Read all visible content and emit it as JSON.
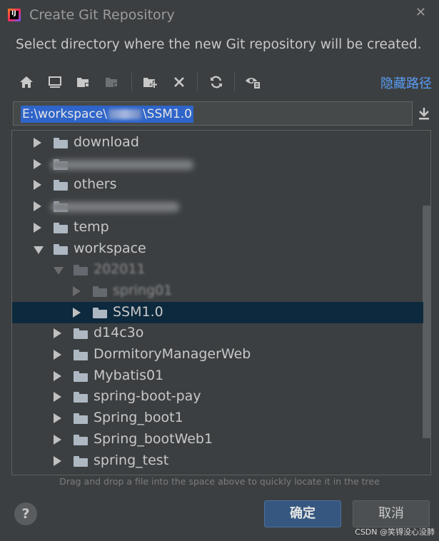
{
  "window": {
    "title": "Create Git Repository"
  },
  "description": "Select directory where the new Git repository will be created.",
  "toolbar": {
    "icons": [
      "home-icon",
      "desktop-icon",
      "project-icon",
      "module-icon",
      "new-folder-icon",
      "delete-icon",
      "refresh-icon",
      "show-hidden-icon"
    ],
    "hide_path_label": "隐藏路径"
  },
  "path": {
    "prefix": "E:\\workspace\\",
    "suffix": "\\SSM1.0"
  },
  "tree": {
    "rows": [
      {
        "label": "download",
        "level": 0,
        "expanded": false,
        "selected": false
      },
      {
        "label": "",
        "level": 0,
        "expanded": false,
        "selected": false,
        "blurred": true
      },
      {
        "label": "others",
        "level": 0,
        "expanded": false,
        "selected": false
      },
      {
        "label": "",
        "level": 0,
        "expanded": false,
        "selected": false,
        "blurred": true
      },
      {
        "label": "temp",
        "level": 0,
        "expanded": false,
        "selected": false
      },
      {
        "label": "workspace",
        "level": 0,
        "expanded": true,
        "selected": false
      },
      {
        "label": "202011",
        "level": 1,
        "expanded": true,
        "selected": false,
        "faded": true
      },
      {
        "label": "spring01",
        "level": 2,
        "expanded": false,
        "selected": false,
        "faded": true
      },
      {
        "label": "SSM1.0",
        "level": 2,
        "expanded": false,
        "selected": true
      },
      {
        "label": "d14c3o",
        "level": 1,
        "expanded": false,
        "selected": false
      },
      {
        "label": "DormitoryManagerWeb",
        "level": 1,
        "expanded": false,
        "selected": false
      },
      {
        "label": "Mybatis01",
        "level": 1,
        "expanded": false,
        "selected": false
      },
      {
        "label": "spring-boot-pay",
        "level": 1,
        "expanded": false,
        "selected": false
      },
      {
        "label": "Spring_boot1",
        "level": 1,
        "expanded": false,
        "selected": false
      },
      {
        "label": "Spring_bootWeb1",
        "level": 1,
        "expanded": false,
        "selected": false
      },
      {
        "label": "spring_test",
        "level": 1,
        "expanded": false,
        "selected": false
      }
    ]
  },
  "hint": "Drag and drop a file into the space above to quickly locate it in the tree",
  "buttons": {
    "ok": "确定",
    "cancel": "取消",
    "help": "?"
  },
  "watermark": "CSDN @笑锝没心没肺",
  "colors": {
    "accent": "#589df6",
    "selection": "#0d293e",
    "ok_button": "#365880"
  }
}
